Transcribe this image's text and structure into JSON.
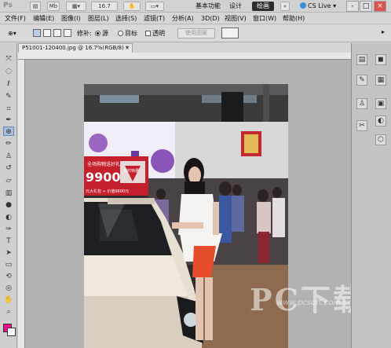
{
  "appbar": {
    "logo": "Ps",
    "mb_label": "Mb",
    "zoom_value": "16.7",
    "workspaces": [
      "基本功能",
      "设计",
      "绘画"
    ],
    "active_workspace": "绘画",
    "cs_live": "CS Live",
    "window_controls": [
      "-",
      "□",
      "×"
    ]
  },
  "menubar": {
    "items": [
      "文件(F)",
      "编辑(E)",
      "图像(I)",
      "图层(L)",
      "选择(S)",
      "滤镜(T)",
      "分析(A)",
      "3D(D)",
      "视图(V)",
      "窗口(W)",
      "帮助(H)"
    ]
  },
  "options": {
    "patch_label": "修补:",
    "source_label": "源",
    "target_label": "目标",
    "transparent_label": "透明",
    "use_pattern_label": "使用图案"
  },
  "document": {
    "tab_label": "P51001-120400.jpg @ 16.7%(RGB/8) *",
    "close": "×"
  },
  "watermark": {
    "main": "PC下载网",
    "url": "www.pcsoft.com.cn"
  },
  "photo": {
    "sign_small": "全场购物送好礼",
    "sign_big": "9900",
    "sign_arrow": "限时特惠",
    "sign_bottom": "元大礼包 + 价值9800元"
  },
  "colors": {
    "foreground": "#ff0a8c",
    "background": "#ffffff",
    "canvas": "#b2b2b2"
  }
}
